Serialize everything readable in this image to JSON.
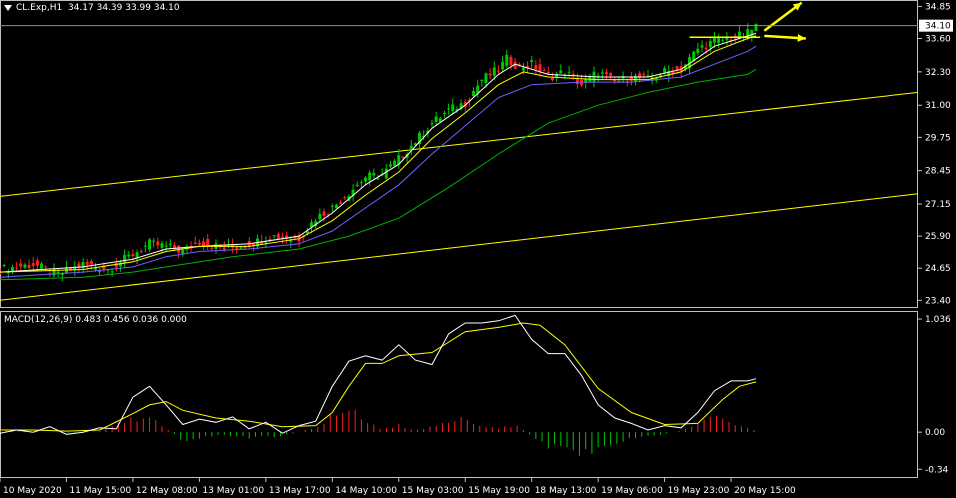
{
  "header": {
    "symbol": "CL.Exp,H1",
    "ohlc": "34.17 34.39 33.99 34.10",
    "macd_label": "MACD(12,26,9) 0.483 0.456 0.036 0.000"
  },
  "colors": {
    "background": "#000000",
    "bull": "#00c800",
    "bear": "#ff2020",
    "ma_fast": "#ffffff",
    "ma_mid": "#ffff00",
    "ma_purple": "#7060ff",
    "ma_slow": "#00b000",
    "channel": "#ffff00",
    "macd_main": "#ffffff",
    "macd_signal": "#ffff00",
    "arrow": "#ffff00",
    "price_tag_bg": "#ffffff"
  },
  "chart_data": [
    {
      "type": "candlestick",
      "title": "CL.Exp,H1",
      "y_ticks": [
        "34.85",
        "33.60",
        "32.30",
        "31.00",
        "29.75",
        "28.45",
        "27.15",
        "25.90",
        "24.65",
        "23.40"
      ],
      "ylim": [
        23.1,
        35.1
      ],
      "current_price": "34.10",
      "x_ticks": [
        "10 May 2020",
        "11 May 15:00",
        "12 May 08:00",
        "13 May 01:00",
        "13 May 17:00",
        "14 May 10:00",
        "15 May 03:00",
        "15 May 19:00",
        "18 May 13:00",
        "19 May 06:00",
        "19 May 23:00",
        "20 May 15:00"
      ],
      "close_path": [
        [
          0,
          24.6
        ],
        [
          8,
          24.8
        ],
        [
          14,
          24.4
        ],
        [
          20,
          24.8
        ],
        [
          26,
          24.6
        ],
        [
          32,
          25.2
        ],
        [
          36,
          25.6
        ],
        [
          40,
          25.5
        ],
        [
          44,
          25.3
        ],
        [
          48,
          25.7
        ],
        [
          54,
          25.4
        ],
        [
          60,
          25.6
        ],
        [
          66,
          25.9
        ],
        [
          72,
          25.8
        ],
        [
          76,
          26.6
        ],
        [
          80,
          27.0
        ],
        [
          84,
          27.6
        ],
        [
          88,
          28.2
        ],
        [
          92,
          28.3
        ],
        [
          96,
          28.9
        ],
        [
          100,
          29.6
        ],
        [
          104,
          30.3
        ],
        [
          108,
          30.8
        ],
        [
          112,
          31.1
        ],
        [
          116,
          32.0
        ],
        [
          120,
          32.4
        ],
        [
          122,
          32.8
        ],
        [
          125,
          32.5
        ],
        [
          128,
          32.6
        ],
        [
          132,
          32.1
        ],
        [
          136,
          32.3
        ],
        [
          140,
          31.8
        ],
        [
          144,
          32.3
        ],
        [
          148,
          31.9
        ],
        [
          152,
          32.1
        ],
        [
          156,
          32.0
        ],
        [
          160,
          32.3
        ],
        [
          164,
          32.4
        ],
        [
          168,
          33.2
        ],
        [
          172,
          33.5
        ],
        [
          176,
          33.6
        ],
        [
          180,
          33.8
        ],
        [
          182,
          34.1
        ]
      ],
      "series": [
        {
          "name": "",
          "style": "ma_fast",
          "values": [
            [
              0,
              24.5
            ],
            [
              20,
              24.7
            ],
            [
              32,
              25.0
            ],
            [
              40,
              25.4
            ],
            [
              48,
              25.5
            ],
            [
              60,
              25.6
            ],
            [
              72,
              25.9
            ],
            [
              80,
              26.8
            ],
            [
              88,
              27.9
            ],
            [
              96,
              28.7
            ],
            [
              104,
              30.1
            ],
            [
              112,
              31.0
            ],
            [
              120,
              32.2
            ],
            [
              124,
              32.6
            ],
            [
              132,
              32.2
            ],
            [
              144,
              32.1
            ],
            [
              156,
              32.1
            ],
            [
              164,
              32.4
            ],
            [
              172,
              33.3
            ],
            [
              180,
              33.7
            ],
            [
              182,
              33.8
            ]
          ]
        },
        {
          "name": "",
          "style": "ma_mid",
          "values": [
            [
              0,
              24.5
            ],
            [
              20,
              24.6
            ],
            [
              32,
              24.9
            ],
            [
              40,
              25.3
            ],
            [
              48,
              25.5
            ],
            [
              60,
              25.5
            ],
            [
              72,
              25.8
            ],
            [
              80,
              26.5
            ],
            [
              88,
              27.5
            ],
            [
              96,
              28.4
            ],
            [
              104,
              29.7
            ],
            [
              112,
              30.7
            ],
            [
              120,
              31.8
            ],
            [
              126,
              32.3
            ],
            [
              132,
              32.1
            ],
            [
              144,
              32.0
            ],
            [
              156,
              32.0
            ],
            [
              164,
              32.3
            ],
            [
              172,
              33.1
            ],
            [
              180,
              33.6
            ],
            [
              182,
              33.7
            ]
          ]
        },
        {
          "name": "",
          "style": "ma_purple",
          "values": [
            [
              0,
              24.3
            ],
            [
              20,
              24.5
            ],
            [
              32,
              24.7
            ],
            [
              40,
              25.1
            ],
            [
              48,
              25.3
            ],
            [
              60,
              25.4
            ],
            [
              72,
              25.6
            ],
            [
              80,
              26.1
            ],
            [
              88,
              27.0
            ],
            [
              96,
              27.9
            ],
            [
              104,
              29.1
            ],
            [
              112,
              30.2
            ],
            [
              120,
              31.3
            ],
            [
              128,
              31.8
            ],
            [
              140,
              31.9
            ],
            [
              152,
              31.9
            ],
            [
              164,
              32.1
            ],
            [
              172,
              32.6
            ],
            [
              180,
              33.1
            ],
            [
              182,
              33.3
            ]
          ]
        },
        {
          "name": "",
          "style": "ma_slow",
          "values": [
            [
              0,
              24.2
            ],
            [
              20,
              24.3
            ],
            [
              32,
              24.5
            ],
            [
              44,
              24.8
            ],
            [
              56,
              25.1
            ],
            [
              72,
              25.4
            ],
            [
              84,
              25.9
            ],
            [
              96,
              26.6
            ],
            [
              108,
              27.8
            ],
            [
              120,
              29.1
            ],
            [
              132,
              30.3
            ],
            [
              144,
              31.0
            ],
            [
              156,
              31.5
            ],
            [
              168,
              31.9
            ],
            [
              180,
              32.2
            ],
            [
              182,
              32.4
            ]
          ]
        }
      ],
      "annotations": {
        "channel_lines": [
          [
            [
              0,
              27.45
            ],
            [
              221,
              31.5
            ]
          ],
          [
            [
              0,
              23.4
            ],
            [
              221,
              27.55
            ]
          ]
        ],
        "resistance_line": [
          [
            166,
            33.65
          ],
          [
            183,
            33.65
          ]
        ],
        "arrows": [
          [
            [
              184,
              33.7
            ],
            [
              194,
              33.6
            ]
          ],
          [
            [
              184,
              33.9
            ],
            [
              193,
              35.0
            ]
          ]
        ]
      }
    },
    {
      "type": "macd",
      "title": "MACD(12,26,9)",
      "values_label": "0.483 0.456 0.036 0.000",
      "y_ticks": [
        "1.036",
        "0.00",
        "-0.34"
      ],
      "ylim": [
        -0.42,
        1.11
      ],
      "main": [
        [
          0,
          -0.01
        ],
        [
          4,
          0.02
        ],
        [
          8,
          0.0
        ],
        [
          12,
          0.05
        ],
        [
          16,
          -0.02
        ],
        [
          20,
          0.0
        ],
        [
          24,
          0.04
        ],
        [
          28,
          0.03
        ],
        [
          32,
          0.32
        ],
        [
          36,
          0.42
        ],
        [
          40,
          0.25
        ],
        [
          44,
          0.07
        ],
        [
          48,
          0.12
        ],
        [
          52,
          0.09
        ],
        [
          56,
          0.14
        ],
        [
          60,
          0.03
        ],
        [
          64,
          0.09
        ],
        [
          68,
          -0.01
        ],
        [
          72,
          0.06
        ],
        [
          76,
          0.1
        ],
        [
          80,
          0.42
        ],
        [
          84,
          0.65
        ],
        [
          88,
          0.7
        ],
        [
          92,
          0.66
        ],
        [
          96,
          0.8
        ],
        [
          100,
          0.66
        ],
        [
          104,
          0.62
        ],
        [
          108,
          0.9
        ],
        [
          112,
          1.0
        ],
        [
          116,
          1.0
        ],
        [
          120,
          1.02
        ],
        [
          124,
          1.07
        ],
        [
          128,
          0.85
        ],
        [
          132,
          0.72
        ],
        [
          136,
          0.72
        ],
        [
          140,
          0.52
        ],
        [
          144,
          0.25
        ],
        [
          148,
          0.13
        ],
        [
          152,
          0.08
        ],
        [
          156,
          0.02
        ],
        [
          160,
          0.06
        ],
        [
          164,
          0.04
        ],
        [
          168,
          0.18
        ],
        [
          172,
          0.38
        ],
        [
          176,
          0.47
        ],
        [
          180,
          0.47
        ],
        [
          182,
          0.49
        ]
      ],
      "signal": [
        [
          0,
          0.02
        ],
        [
          8,
          0.02
        ],
        [
          16,
          0.01
        ],
        [
          24,
          0.02
        ],
        [
          32,
          0.17
        ],
        [
          36,
          0.25
        ],
        [
          40,
          0.28
        ],
        [
          44,
          0.2
        ],
        [
          52,
          0.13
        ],
        [
          60,
          0.1
        ],
        [
          68,
          0.05
        ],
        [
          76,
          0.06
        ],
        [
          80,
          0.18
        ],
        [
          84,
          0.42
        ],
        [
          88,
          0.63
        ],
        [
          92,
          0.63
        ],
        [
          96,
          0.7
        ],
        [
          104,
          0.73
        ],
        [
          112,
          0.92
        ],
        [
          120,
          0.96
        ],
        [
          126,
          1.0
        ],
        [
          130,
          0.98
        ],
        [
          136,
          0.8
        ],
        [
          144,
          0.4
        ],
        [
          152,
          0.18
        ],
        [
          160,
          0.07
        ],
        [
          168,
          0.08
        ],
        [
          174,
          0.3
        ],
        [
          178,
          0.42
        ],
        [
          182,
          0.46
        ]
      ],
      "histogram_envelope": [
        [
          0,
          0.02
        ],
        [
          8,
          0.01
        ],
        [
          16,
          -0.01
        ],
        [
          24,
          0.01
        ],
        [
          28,
          0.08
        ],
        [
          32,
          0.15
        ],
        [
          36,
          0.18
        ],
        [
          40,
          0.05
        ],
        [
          44,
          -0.1
        ],
        [
          52,
          -0.03
        ],
        [
          60,
          -0.06
        ],
        [
          68,
          -0.04
        ],
        [
          76,
          0.05
        ],
        [
          80,
          0.18
        ],
        [
          84,
          0.28
        ],
        [
          88,
          0.12
        ],
        [
          92,
          0.03
        ],
        [
          96,
          0.08
        ],
        [
          100,
          0.02
        ],
        [
          108,
          0.1
        ],
        [
          112,
          0.16
        ],
        [
          116,
          0.06
        ],
        [
          120,
          0.04
        ],
        [
          124,
          0.08
        ],
        [
          128,
          -0.04
        ],
        [
          132,
          -0.15
        ],
        [
          136,
          -0.2
        ],
        [
          140,
          -0.26
        ],
        [
          144,
          -0.18
        ],
        [
          148,
          -0.12
        ],
        [
          152,
          -0.08
        ],
        [
          156,
          -0.04
        ],
        [
          160,
          -0.02
        ],
        [
          164,
          0.02
        ],
        [
          168,
          0.1
        ],
        [
          172,
          0.16
        ],
        [
          176,
          0.1
        ],
        [
          180,
          0.04
        ],
        [
          182,
          0.03
        ]
      ]
    }
  ]
}
